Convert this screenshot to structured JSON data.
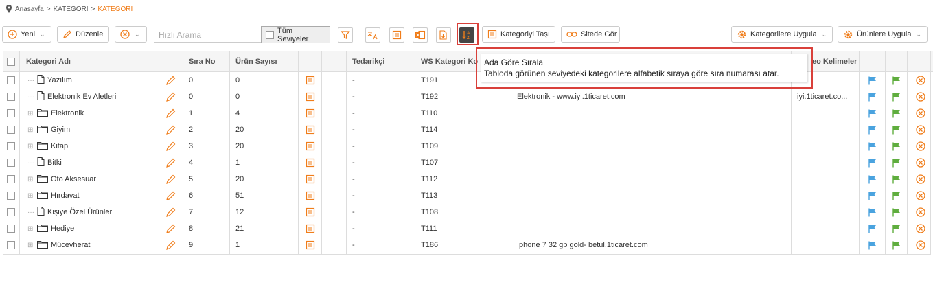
{
  "breadcrumb": {
    "home": "Anasayfa",
    "sep": ">",
    "level1": "KATEGORİ",
    "current": "KATEGORİ"
  },
  "toolbar": {
    "new_label": "Yeni",
    "edit_label": "Düzenle",
    "search_placeholder": "Hızlı Arama",
    "all_levels_label": "Tüm Seviyeler",
    "move_category_label": "Kategoriyi Taşı",
    "view_on_site_label": "Sitede Gör",
    "apply_categories_label": "Kategorilere Uygula",
    "apply_products_label": "Ürünlere Uygula"
  },
  "tooltip": {
    "title": "Ada Göre Sırala",
    "text": "Tabloda görünen seviyedeki kategorilere alfabetik sıraya göre sıra numarası atar."
  },
  "columns": {
    "name": "Kategori Adı",
    "order": "Sıra No",
    "product_count": "Ürün Sayısı",
    "supplier": "Tedarikçi",
    "ws_code": "WS Kategori Ko",
    "seo_keywords": "eo Kelimeler"
  },
  "rows": [
    {
      "name": "Yazılım",
      "type": "leaf",
      "order": "0",
      "count": "0",
      "supplier": "-",
      "ws": "T191",
      "desc": "",
      "seo": ""
    },
    {
      "name": "Elektronik Ev Aletleri",
      "type": "leaf",
      "order": "0",
      "count": "0",
      "supplier": "-",
      "ws": "T192",
      "desc": "Elektronik - www.iyi.1ticaret.com",
      "seo": "iyi.1ticaret.co..."
    },
    {
      "name": "Elektronik",
      "type": "folder",
      "order": "1",
      "count": "4",
      "supplier": "-",
      "ws": "T110",
      "desc": "",
      "seo": ""
    },
    {
      "name": "Giyim",
      "type": "folder",
      "order": "2",
      "count": "20",
      "supplier": "-",
      "ws": "T114",
      "desc": "",
      "seo": ""
    },
    {
      "name": "Kitap",
      "type": "folder",
      "order": "3",
      "count": "20",
      "supplier": "-",
      "ws": "T109",
      "desc": "",
      "seo": ""
    },
    {
      "name": "Bitki",
      "type": "leaf",
      "order": "4",
      "count": "1",
      "supplier": "-",
      "ws": "T107",
      "desc": "",
      "seo": ""
    },
    {
      "name": "Oto Aksesuar",
      "type": "folder",
      "order": "5",
      "count": "20",
      "supplier": "-",
      "ws": "T112",
      "desc": "",
      "seo": ""
    },
    {
      "name": "Hırdavat",
      "type": "folder",
      "order": "6",
      "count": "51",
      "supplier": "-",
      "ws": "T113",
      "desc": "",
      "seo": ""
    },
    {
      "name": "Kişiye Özel Ürünler",
      "type": "leaf",
      "order": "7",
      "count": "12",
      "supplier": "-",
      "ws": "T108",
      "desc": "",
      "seo": ""
    },
    {
      "name": "Hediye",
      "type": "folder",
      "order": "8",
      "count": "21",
      "supplier": "-",
      "ws": "T111",
      "desc": "",
      "seo": ""
    },
    {
      "name": "Mücevherat",
      "type": "folder",
      "order": "9",
      "count": "1",
      "supplier": "-",
      "ws": "T186",
      "desc": "ıphone 7 32 gb gold- betul.1ticaret.com",
      "seo": ""
    }
  ],
  "colors": {
    "accent": "#f07d1a",
    "flag_blue": "#4aa3df",
    "flag_green": "#5fad3e",
    "highlight": "#d9403a"
  }
}
